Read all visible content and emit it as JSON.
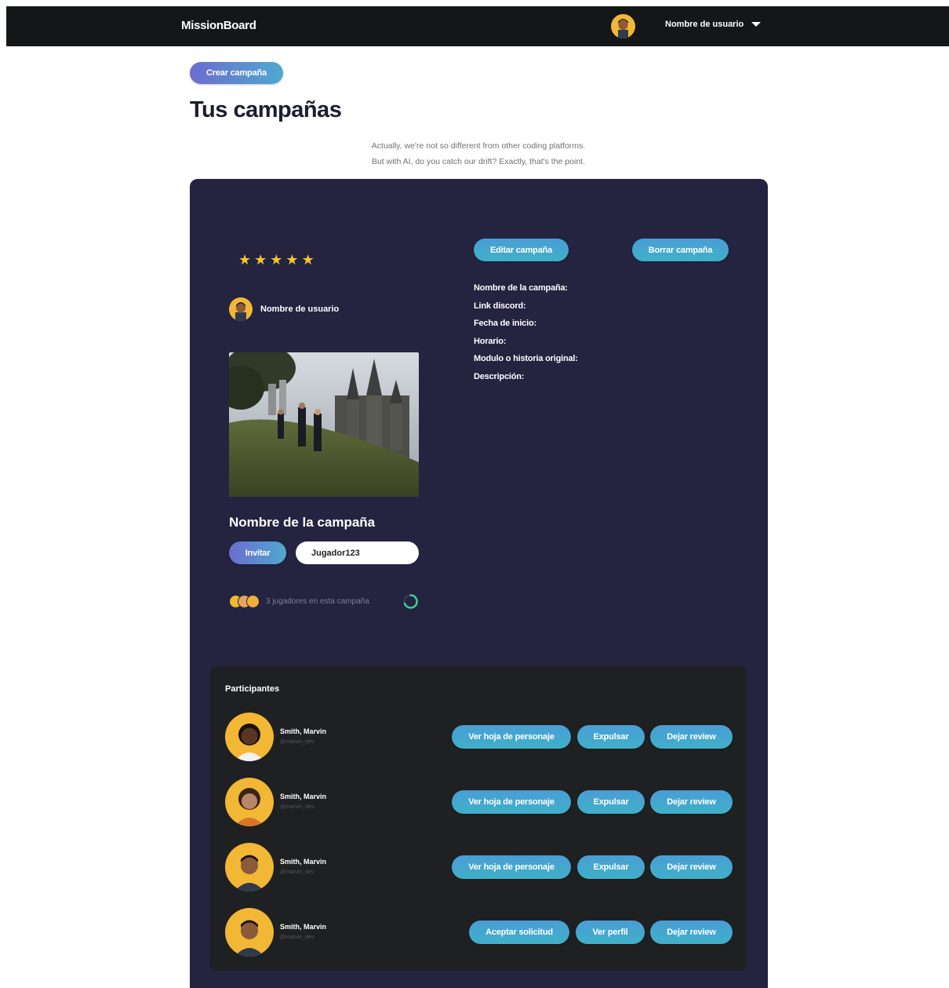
{
  "app": {
    "brand": "MissionBoard"
  },
  "header": {
    "username": "Nombre de usuario",
    "avatar_icon": "user-avatar",
    "caret_icon": "chevron-down-icon"
  },
  "actions": {
    "create_campaign": "Crear campaña"
  },
  "page": {
    "title": "Tus campañas",
    "subtitle_line1": "Actually, we're not so different from other coding platforms.",
    "subtitle_line2": "But with AI, do you catch our drift? Exactly, that's the point."
  },
  "campaign": {
    "rating": 5,
    "owner_name": "Nombre de usuario",
    "name": "Nombre de la campaña",
    "edit_label": "Editar campaña",
    "delete_label": "Borrar campaña",
    "invite_label": "Invitar",
    "invite_value": "Jugador123",
    "players_text": "3 jugadores en esta campaña",
    "fields": {
      "name": "Nombre de la campaña:",
      "discord": "Link discord:",
      "start_date": "Fecha de inicio:",
      "schedule": "Horario:",
      "module": "Modulo o historia original:",
      "description": "Descripción:"
    }
  },
  "participants": {
    "title": "Participantes",
    "rows": [
      {
        "name": "Smith, Marvin",
        "handle": "@marvin_dev",
        "btn1": "Ver hoja de personaje",
        "btn2": "Expulsar",
        "btn3": "Dejar review"
      },
      {
        "name": "Smith, Marvin",
        "handle": "@marvin_dev",
        "btn1": "Ver hoja de personaje",
        "btn2": "Expulsar",
        "btn3": "Dejar review"
      },
      {
        "name": "Smith, Marvin",
        "handle": "@marvin_dev",
        "btn1": "Ver hoja de personaje",
        "btn2": "Expulsar",
        "btn3": "Dejar review"
      },
      {
        "name": "Smith, Marvin",
        "handle": "@marvin_dev",
        "btn1": "Aceptar solicitud",
        "btn2": "Ver perfil",
        "btn3": "Dejar review"
      }
    ]
  },
  "colors": {
    "topbar": "#151618",
    "card": "#242340",
    "panel": "#1f2022",
    "star": "#f6c42c",
    "avatar_bg": "#f3b736"
  }
}
